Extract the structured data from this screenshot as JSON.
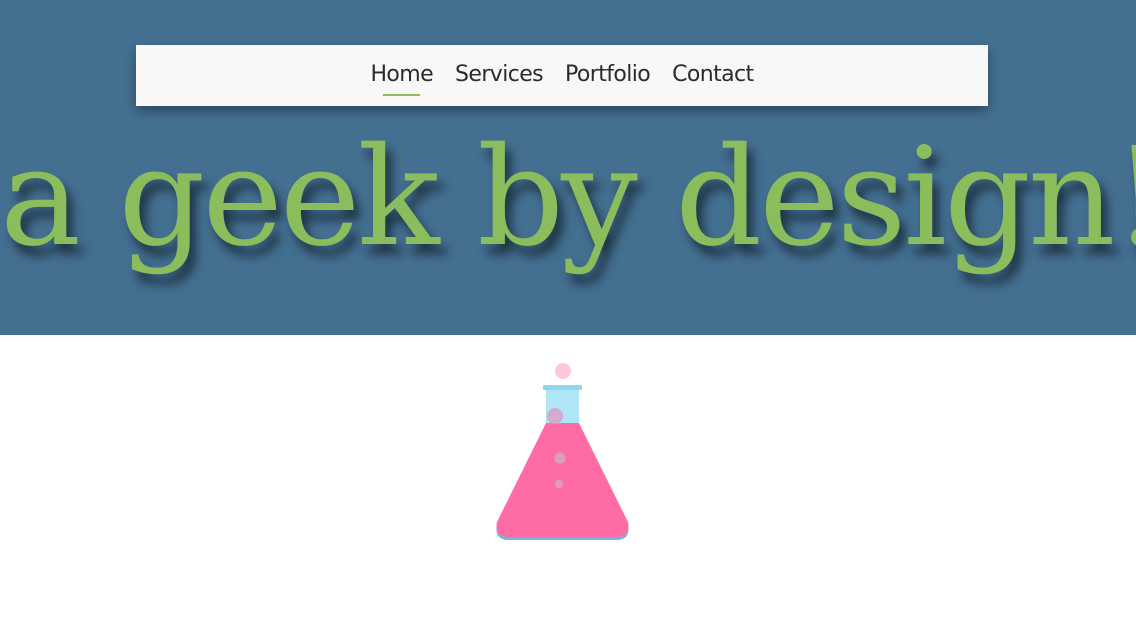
{
  "nav": {
    "items": [
      {
        "label": "Home",
        "active": true
      },
      {
        "label": "Services",
        "active": false
      },
      {
        "label": "Portfolio",
        "active": false
      },
      {
        "label": "Contact",
        "active": false
      }
    ]
  },
  "hero": {
    "headline": "a geek by design!"
  },
  "illustration": {
    "icon": "flask-icon"
  },
  "colors": {
    "hero_background": "#436f91",
    "accent_green": "#8bbd5c",
    "navbar_background": "#f8f8f8",
    "flask_liquid": "#ff6ba4",
    "flask_glass": "#aee6f7",
    "flask_base": "#6fb6e6"
  }
}
